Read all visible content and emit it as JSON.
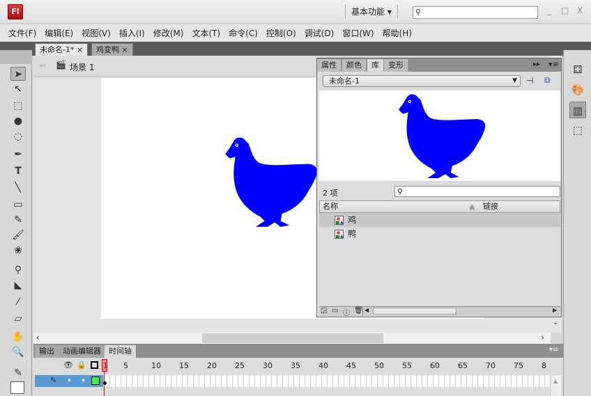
{
  "app": {
    "logo": "Fl",
    "workspace": "基本功能",
    "window_controls": [
      "_",
      "□",
      "X"
    ]
  },
  "menu": [
    "文件(F)",
    "编辑(E)",
    "视图(V)",
    "插入(I)",
    "修改(M)",
    "文本(T)",
    "命令(C)",
    "控制(O)",
    "调试(D)",
    "窗口(W)",
    "帮助(H)"
  ],
  "doc_tabs": [
    {
      "label": "未命名-1*",
      "close": "×"
    },
    {
      "label": "鸡变鸭",
      "close": "×"
    }
  ],
  "scene": {
    "label": "场景 1"
  },
  "library": {
    "tabs": [
      "属性",
      "颜色",
      "库",
      "变形"
    ],
    "active_tab": "库",
    "document": "未命名-1",
    "count": "2 项",
    "columns": {
      "name": "名称",
      "linkage": "链接"
    },
    "items": [
      {
        "name": "鸡",
        "selected": true
      },
      {
        "name": "鸭",
        "selected": false
      }
    ]
  },
  "timeline": {
    "tabs": [
      "输出",
      "动画编辑器",
      "时间轴"
    ],
    "active_tab": "时间轴",
    "frame_numbers": [
      "1",
      "5",
      "10",
      "15",
      "20",
      "25",
      "30",
      "35",
      "40",
      "45",
      "50",
      "55",
      "60",
      "65",
      "70",
      "75",
      "8"
    ]
  },
  "colors": {
    "shape": "#0000ff",
    "accent_red": "#e03a3a",
    "layer_selected": "#5a9ad6",
    "keyframe_green": "#44ee44"
  }
}
